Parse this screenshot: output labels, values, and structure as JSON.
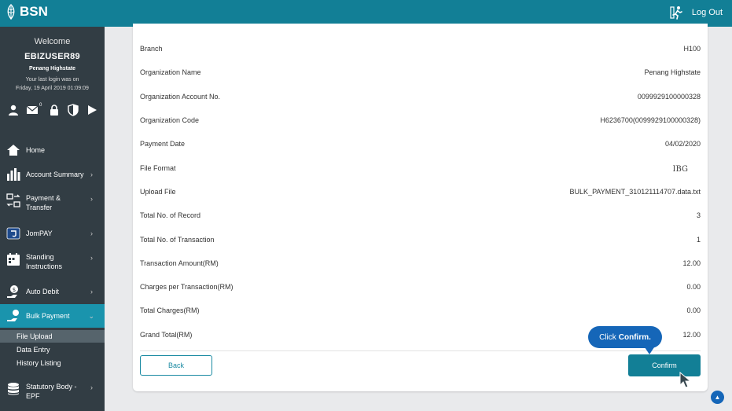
{
  "header": {
    "brand": "BSN",
    "logout_label": "Log Out"
  },
  "sidebar": {
    "welcome": "Welcome",
    "username": "EBIZUSER89",
    "company": "Penang Highstate",
    "last_login_line1": "Your last login was on",
    "last_login_line2": "Friday, 19 April 2019 01:09:09",
    "mail_count": "0",
    "menu": [
      {
        "label": "Home"
      },
      {
        "label": "Account Summary"
      },
      {
        "label": "Payment &"
      },
      {
        "label": "Transfer"
      },
      {
        "label": "JomPAY"
      },
      {
        "label": "Standing"
      },
      {
        "label": "Instructions"
      },
      {
        "label": "Auto Debit"
      },
      {
        "label": "Bulk Payment"
      },
      {
        "label": "Statutory Body -"
      },
      {
        "label": "EPF"
      }
    ],
    "submenu": [
      "File Upload",
      "Data Entry",
      "History Listing"
    ]
  },
  "details": [
    {
      "label": "Branch",
      "value": "H100"
    },
    {
      "label": "Organization Name",
      "value": "Penang Highstate"
    },
    {
      "label": "Organization Account No.",
      "value": "0099929100000328"
    },
    {
      "label": "Organization Code",
      "value": "H6236700(0099929100000328)"
    },
    {
      "label": "Payment Date",
      "value": "04/02/2020"
    },
    {
      "label": "File Format",
      "value": "IBG"
    },
    {
      "label": "Upload File",
      "value": "BULK_PAYMENT_310121114707.data.txt"
    },
    {
      "label": "Total No. of Record",
      "value": "3"
    },
    {
      "label": "Total No. of Transaction",
      "value": "1"
    },
    {
      "label": "Transaction Amount(RM)",
      "value": "12.00"
    },
    {
      "label": "Charges per Transaction(RM)",
      "value": "0.00"
    },
    {
      "label": "Total Charges(RM)",
      "value": "0.00"
    },
    {
      "label": "Grand Total(RM)",
      "value": "12.00"
    }
  ],
  "actions": {
    "back_label": "Back",
    "confirm_label": "Confirm"
  },
  "tooltip": {
    "prefix": "Click",
    "bold": "Confirm."
  },
  "colors": {
    "primary": "#127f96",
    "sidebar": "#323d44",
    "active": "#1a94ad",
    "tooltip": "#1566b8"
  }
}
